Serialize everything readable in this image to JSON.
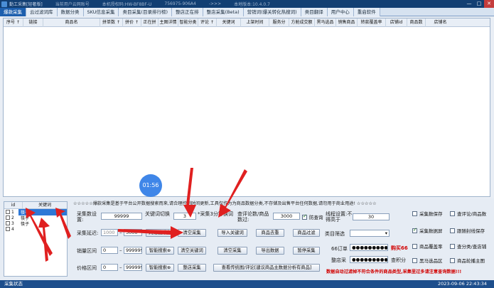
{
  "window": {
    "title": "勤工采集[轻奢版] 当前用户云网账号 本机授权码:HW-BF8BF-U 756975-906A4 ->>> 本地版本:10.4.0.7",
    "title_parts": [
      "勤工采集[轻奢版]",
      "当前用户云网账号",
      "本机授权码:HW-BF8BF-U",
      "756975-906A4",
      "->>>",
      "本地版本:10.4.0.7"
    ],
    "controls": [
      "—",
      "□",
      "✕"
    ]
  },
  "tabs": [
    "爆款采集",
    "云过滤词库",
    "数据分类",
    "SKU信息采集",
    "类目采集(目录排行榜)",
    "整店正在排",
    "整店采集(Beta)",
    "营销词(爆关转化热搜词)",
    "类目翻译",
    "用户中心",
    "重启软件"
  ],
  "active_tab": "爆款采集",
  "grid": {
    "columns": [
      "序号 ↑",
      "链接",
      "商品名",
      "拼单数 ↑",
      "拼价 ↑",
      "正在拼",
      "主图详情",
      "智能分类",
      "评论 ↑",
      "关键词",
      "上架时间",
      "服务分",
      "方舱成交额",
      "黑马选品",
      "销售商品",
      "转款覆盖率",
      "店铺id",
      "商品数",
      "店铺名"
    ],
    "rows": []
  },
  "keyword_panel": {
    "header_id": "id",
    "header_kw": "关键词",
    "rows": [
      {
        "id": "1",
        "kw": "筷子",
        "selected": true
      },
      {
        "id": "2",
        "kw": "筷子",
        "selected": false
      },
      {
        "id": "3",
        "kw": "筷子",
        "selected": false
      },
      {
        "id": "4",
        "kw": "",
        "selected": false
      }
    ]
  },
  "notice": "☆☆☆☆☆爆款采集是基于平台公开数据搜索而来,请合理控制时间更新,工具仅作为为商品数据分类,不存储及出售平台任何数据,请勿用于商业用途! ☆☆☆☆☆",
  "form": {
    "collect_count_label": "采集数设置:",
    "collect_count": "99999",
    "switch_label": "关键词切换",
    "switch_value": "3",
    "switch_unit": "*采集3分钟换词",
    "review_label": "查评论数/商品数过:",
    "review_value": "3000",
    "anti_block": "防查询",
    "filter_label": "线程设置:不得高于",
    "filter_value": "30",
    "delay_label": "采集延迟:",
    "delay_min": "1000",
    "delay_max": "3000",
    "sales_label": "销量区间",
    "sales_min": "0",
    "sales_max": "999999",
    "price_label": "价格区间",
    "price_min": "0",
    "price_max": "999999",
    "category_label": "类目筛选",
    "order_label": "66订单",
    "order_value": "●●●●●●●●●●●●",
    "buy_label": "购买66",
    "store_label": "整店采",
    "store_value": "●●●●●●●●●●●●",
    "query_points": "查积分"
  },
  "buttons": {
    "row1": [
      "网络搜采集",
      "清空采集",
      "导入关键词",
      "商品去重",
      "商品过滤"
    ],
    "row2": [
      "智能搜索⊕",
      "清空关键词",
      "清空采集",
      "导出数据",
      "暂停采集"
    ],
    "row3": [
      "智能搜索⊕",
      "整店采集",
      "查看传统图/评论[建议商品主数据分析有商品]"
    ]
  },
  "checkboxes": [
    {
      "label": "采集数保存",
      "checked": false
    },
    {
      "label": "查评论/商品数",
      "checked": false
    },
    {
      "label": "采集数据屏",
      "checked": true
    },
    {
      "label": "跟随封线保存",
      "checked": false
    },
    {
      "label": "商品覆盖率",
      "checked": false
    },
    {
      "label": "查分类/查店铺",
      "checked": false
    },
    {
      "label": "黑马选品区",
      "checked": false
    },
    {
      "label": "商品轮播主图",
      "checked": false
    }
  ],
  "warning": "数据自动过滤掉不符合条件的商品类型,采集里过多请注意查询数据!!!",
  "status": {
    "left": "采集状态",
    "datetime": "2023-09-06 22:43:34"
  },
  "timer": "01:56"
}
